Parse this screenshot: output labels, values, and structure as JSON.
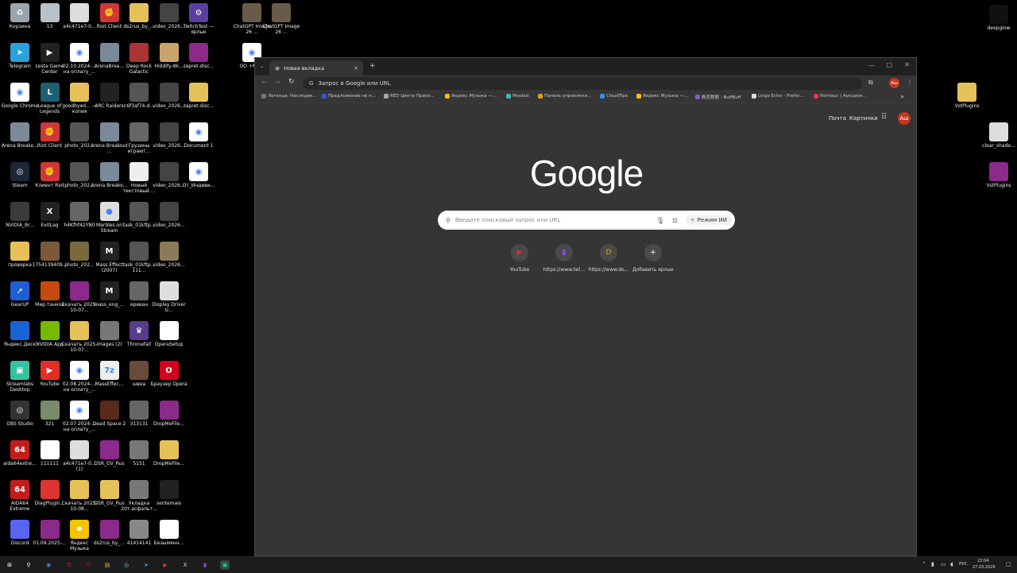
{
  "desktop_icons": [
    {
      "label": "Корзина",
      "icon": "recycle-bin-icon",
      "color": "#9aa4ad",
      "glyph": "♻"
    },
    {
      "label": "13",
      "icon": "file-icon",
      "color": "#b8c0c8",
      "glyph": ""
    },
    {
      "label": "a4c471e7-0...",
      "icon": "image-file-icon",
      "color": "#ddd",
      "glyph": ""
    },
    {
      "label": "Riot Client",
      "icon": "riot-client-icon",
      "color": "#d13639",
      "glyph": "✊"
    },
    {
      "label": "ds2rus_by_...",
      "icon": "folder-icon",
      "color": "#e6c15a",
      "glyph": ""
    },
    {
      "label": "video_2026...",
      "icon": "video-file-icon",
      "color": "#444",
      "glyph": ""
    },
    {
      "label": "TwitchTest — ярлык",
      "icon": "twitch-test-icon",
      "color": "#5b3fa0",
      "glyph": "⚙"
    },
    {
      "label": "Telegram",
      "icon": "telegram-icon",
      "color": "#2aa1da",
      "glyph": "➤"
    },
    {
      "label": "Lesta Game Center",
      "icon": "lesta-game-center-icon",
      "color": "#222",
      "glyph": "▶"
    },
    {
      "label": "02.10.2024-... на оплату_...",
      "icon": "chrome-doc-icon",
      "color": "#fff",
      "glyph": "◉"
    },
    {
      "label": "ArenaBrea...",
      "icon": "arena-breakout-icon",
      "color": "#7a8a99",
      "glyph": ""
    },
    {
      "label": "Deep Rock Galactic",
      "icon": "deep-rock-galactic-icon",
      "color": "#a33",
      "glyph": ""
    },
    {
      "label": "Hiddify-Wi...",
      "icon": "hiddify-icon",
      "color": "#c9a46a",
      "glyph": ""
    },
    {
      "label": "zapret-disc...",
      "icon": "winrar-icon",
      "color": "#8b2a8a",
      "glyph": ""
    },
    {
      "label": "Google Chrome",
      "icon": "chrome-icon",
      "color": "#fff",
      "glyph": "◉"
    },
    {
      "label": "League of Legends",
      "icon": "league-of-legends-icon",
      "color": "#1d5f73",
      "glyph": "L"
    },
    {
      "label": "goodbyed... — копия",
      "icon": "folder-icon",
      "color": "#e6c15a",
      "glyph": ""
    },
    {
      "label": "ARC Raiders",
      "icon": "arc-raiders-icon",
      "color": "#222",
      "glyph": ""
    },
    {
      "label": "c6f3af74-d...",
      "icon": "image-file-icon",
      "color": "#555",
      "glyph": ""
    },
    {
      "label": "video_2026...",
      "icon": "video-file-icon",
      "color": "#444",
      "glyph": ""
    },
    {
      "label": "zapret-disc...",
      "icon": "folder-icon",
      "color": "#e6c15a",
      "glyph": ""
    },
    {
      "label": "Arena Breako...",
      "icon": "arena-breakout-icon",
      "color": "#7a8a99",
      "glyph": ""
    },
    {
      "label": "Riot Client",
      "icon": "riot-client-icon",
      "color": "#d13639",
      "glyph": "✊"
    },
    {
      "label": "photo_202...",
      "icon": "photo-file-icon",
      "color": "#555",
      "glyph": ""
    },
    {
      "label": "Arena Breakout ...",
      "icon": "arena-breakout-icon",
      "color": "#7a8a99",
      "glyph": ""
    },
    {
      "label": "Грузины играют...",
      "icon": "video-file-icon",
      "color": "#666",
      "glyph": ""
    },
    {
      "label": "video_2026...",
      "icon": "video-file-icon",
      "color": "#444",
      "glyph": ""
    },
    {
      "label": "Document 1",
      "icon": "chrome-doc-icon",
      "color": "#fff",
      "glyph": "◉"
    },
    {
      "label": "Steam",
      "icon": "steam-icon",
      "color": "#1b2838",
      "glyph": "◎"
    },
    {
      "label": "Клиент Riot",
      "icon": "riot-client-icon",
      "color": "#d13639",
      "glyph": "✊"
    },
    {
      "label": "photo_202...",
      "icon": "photo-file-icon",
      "color": "#555",
      "glyph": ""
    },
    {
      "label": "Arena Breako...",
      "icon": "arena-breakout-icon",
      "color": "#7a8a99",
      "glyph": ""
    },
    {
      "label": "Новый текстовый ...",
      "icon": "text-file-icon",
      "color": "#eee",
      "glyph": ""
    },
    {
      "label": "video_2026...",
      "icon": "video-file-icon",
      "color": "#444",
      "glyph": ""
    },
    {
      "label": "От_Индиви...",
      "icon": "chrome-doc-icon",
      "color": "#fff",
      "glyph": "◉"
    },
    {
      "label": "NVIDIA_Br...",
      "icon": "nvidia-icon",
      "color": "#3b3b3b",
      "glyph": ""
    },
    {
      "label": "ExitLag",
      "icon": "exitlag-icon",
      "color": "#222",
      "glyph": "X"
    },
    {
      "label": "h4Kfhf42YN0",
      "icon": "photo-file-icon",
      "color": "#666",
      "glyph": ""
    },
    {
      "label": "Marbles on Stream",
      "icon": "marbles-icon",
      "color": "#ddd",
      "glyph": "●"
    },
    {
      "label": "task_01kftp...",
      "icon": "video-file-icon",
      "color": "#555",
      "glyph": ""
    },
    {
      "label": "video_2026...",
      "icon": "video-file-icon",
      "color": "#444",
      "glyph": ""
    },
    {
      "label": "",
      "icon": "",
      "color": "",
      "glyph": ""
    },
    {
      "label": "проверка",
      "icon": "folder-icon",
      "color": "#e6c15a",
      "glyph": ""
    },
    {
      "label": "1754139409...",
      "icon": "photo-file-icon",
      "color": "#7a5a3a",
      "glyph": ""
    },
    {
      "label": "photo_202...",
      "icon": "photo-file-icon",
      "color": "#7a6a3a",
      "glyph": ""
    },
    {
      "label": "Mass Effect (2007)",
      "icon": "mass-effect-icon",
      "color": "#222",
      "glyph": "M"
    },
    {
      "label": "task_01kftp... 111...",
      "icon": "video-file-icon",
      "color": "#555",
      "glyph": ""
    },
    {
      "label": "video_2026...",
      "icon": "video-file-icon",
      "color": "#8a7a5a",
      "glyph": ""
    },
    {
      "label": "",
      "icon": "",
      "color": "",
      "glyph": ""
    },
    {
      "label": "GearUP",
      "icon": "gearup-icon",
      "color": "#1f5fd1",
      "glyph": "➚"
    },
    {
      "label": "Мир танков",
      "icon": "world-of-tanks-icon",
      "color": "#c54a12",
      "glyph": ""
    },
    {
      "label": "Скачать 2025-10-07...",
      "icon": "winrar-icon",
      "color": "#8b2a8a",
      "glyph": ""
    },
    {
      "label": "mass_eng_...",
      "icon": "mass-effect-icon",
      "color": "#222",
      "glyph": "M"
    },
    {
      "label": "ереван",
      "icon": "photo-file-icon",
      "color": "#666",
      "glyph": ""
    },
    {
      "label": "Display Driver U...",
      "icon": "ddu-icon",
      "color": "#ddd",
      "glyph": ""
    },
    {
      "label": "",
      "icon": "",
      "color": "",
      "glyph": ""
    },
    {
      "label": "Яндекс.Диск",
      "icon": "yandex-disk-icon",
      "color": "#1a63d6",
      "glyph": ""
    },
    {
      "label": "NVIDIA App",
      "icon": "nvidia-app-icon",
      "color": "#76b900",
      "glyph": ""
    },
    {
      "label": "Скачать 2025-10-07...",
      "icon": "folder-icon",
      "color": "#e6c15a",
      "glyph": ""
    },
    {
      "label": "images (2)",
      "icon": "image-file-icon",
      "color": "#777",
      "glyph": ""
    },
    {
      "label": "Thronefall",
      "icon": "thronefall-icon",
      "color": "#5a3a8a",
      "glyph": "♛"
    },
    {
      "label": "OperaSetup",
      "icon": "opera-setup-icon",
      "color": "#fff",
      "glyph": ""
    },
    {
      "label": "",
      "icon": "",
      "color": "",
      "glyph": ""
    },
    {
      "label": "Streamlabs Desktop",
      "icon": "streamlabs-icon",
      "color": "#31c3a2",
      "glyph": "▣"
    },
    {
      "label": "YouTube",
      "icon": "youtube-icon",
      "color": "#e52d27",
      "glyph": "▶"
    },
    {
      "label": "02.08.2024-... на оплату_...",
      "icon": "chrome-doc-icon",
      "color": "#fff",
      "glyph": "◉"
    },
    {
      "label": "MassEffec...",
      "icon": "7zip-icon",
      "color": "#eee",
      "glyph": "7z"
    },
    {
      "label": "швеа",
      "icon": "photo-file-icon",
      "color": "#6a4a3a",
      "glyph": ""
    },
    {
      "label": "Браузер Opera",
      "icon": "opera-icon",
      "color": "#d5001c",
      "glyph": "O"
    },
    {
      "label": "",
      "icon": "",
      "color": "",
      "glyph": ""
    },
    {
      "label": "OBS Studio",
      "icon": "obs-icon",
      "color": "#333",
      "glyph": "◎"
    },
    {
      "label": "321",
      "icon": "image-file-icon",
      "color": "#7a8a6a",
      "glyph": ""
    },
    {
      "label": "02.07.2024-... на оплату_...",
      "icon": "chrome-doc-icon",
      "color": "#fff",
      "glyph": "◉"
    },
    {
      "label": "Dead Space 2",
      "icon": "dead-space-icon",
      "color": "#5a2a1a",
      "glyph": ""
    },
    {
      "label": "313131",
      "icon": "photo-file-icon",
      "color": "#666",
      "glyph": ""
    },
    {
      "label": "DropMeFile...",
      "icon": "winrar-icon",
      "color": "#8b2a8a",
      "glyph": ""
    },
    {
      "label": "",
      "icon": "",
      "color": "",
      "glyph": ""
    },
    {
      "label": "aida64extre...",
      "icon": "aida64-icon",
      "color": "#c41c1c",
      "glyph": "64"
    },
    {
      "label": "111111",
      "icon": "image-file-icon",
      "color": "#fff",
      "glyph": ""
    },
    {
      "label": "a4c471e7-0... (1)",
      "icon": "image-file-icon",
      "color": "#ddd",
      "glyph": ""
    },
    {
      "label": "DSR_GV_Rus",
      "icon": "winrar-icon",
      "color": "#8b2a8a",
      "glyph": ""
    },
    {
      "label": "5151",
      "icon": "photo-file-icon",
      "color": "#777",
      "glyph": ""
    },
    {
      "label": "DropMeFile...",
      "icon": "folder-icon",
      "color": "#e6c15a",
      "glyph": ""
    },
    {
      "label": "",
      "icon": "",
      "color": "",
      "glyph": ""
    },
    {
      "label": "AIDA64 Extreme",
      "icon": "aida64-icon",
      "color": "#c41c1c",
      "glyph": "64"
    },
    {
      "label": "DiagPlugin...",
      "icon": "diag-plugin-icon",
      "color": "#d33",
      "glyph": ""
    },
    {
      "label": "Скачать 2025-10-08...",
      "icon": "folder-icon",
      "color": "#e6c15a",
      "glyph": ""
    },
    {
      "label": "DSR_GV_Rus",
      "icon": "folder-icon",
      "color": "#e6c15a",
      "glyph": ""
    },
    {
      "label": "Укладка 20т.асфальт...",
      "icon": "photo-file-icon",
      "color": "#777",
      "glyph": ""
    },
    {
      "label": "sentemais",
      "icon": "image-file-icon",
      "color": "#222",
      "glyph": ""
    },
    {
      "label": "",
      "icon": "",
      "color": "",
      "glyph": ""
    },
    {
      "label": "Discord",
      "icon": "discord-icon",
      "color": "#5865f2",
      "glyph": ""
    },
    {
      "label": "01.09.2025-...",
      "icon": "winrar-icon",
      "color": "#8b2a8a",
      "glyph": ""
    },
    {
      "label": "Яндекс Музыка",
      "icon": "yandex-music-icon",
      "color": "#f5c400",
      "glyph": "✸"
    },
    {
      "label": "ds2rus_by_...",
      "icon": "winrar-icon",
      "color": "#8b2a8a",
      "glyph": ""
    },
    {
      "label": "41414141",
      "icon": "photo-file-icon",
      "color": "#888",
      "glyph": ""
    },
    {
      "label": "Безымянн...",
      "icon": "image-file-icon",
      "color": "#fff",
      "glyph": ""
    },
    {
      "label": "",
      "icon": "",
      "color": "",
      "glyph": ""
    }
  ],
  "top_files": [
    {
      "label": "ChatGPT Image 26 ...",
      "icon": "image-file-icon"
    },
    {
      "label": "ChatGPT Image 26 ...",
      "icon": "image-file-icon"
    },
    {
      "label": "OO +МАРІ",
      "icon": "chrome-doc-icon"
    }
  ],
  "right_icons": [
    {
      "label": "deepglow",
      "icon": "deepglow-icon",
      "color": "#111"
    },
    {
      "label": "VstPlugins",
      "icon": "folder-icon",
      "color": "#e6c15a"
    },
    {
      "label": "clear_shade...",
      "icon": "image-file-icon",
      "color": "#ddd"
    },
    {
      "label": "VstPlugins",
      "icon": "winrar-icon",
      "color": "#8b2a8a"
    }
  ],
  "chrome": {
    "tab_title": "Новая вкладка",
    "omnibox_placeholder": "Запрос в Google или URL",
    "profile_initials": "Аш",
    "header_links": {
      "mail": "Почта",
      "images": "Картинки"
    },
    "logo": "Google",
    "search_placeholder": "Введите поисковый запрос или URL",
    "ai_mode_label": "Режим ИИ",
    "bookmarks": [
      {
        "label": "Легенда: Наследие...",
        "color": "#777"
      },
      {
        "label": "Предложение не н...",
        "color": "#2b5bd7"
      },
      {
        "label": "RED Центр Прихо...",
        "color": "#aaa"
      },
      {
        "label": "Яндекс Музыка —...",
        "color": "#f5c400"
      },
      {
        "label": "Moobot",
        "color": "#3bb"
      },
      {
        "label": "Панель управлени...",
        "color": "#f39c12"
      },
      {
        "label": "CloudTips",
        "color": "#3a8ee6"
      },
      {
        "label": "Яндекс Музыка —...",
        "color": "#f5c400"
      },
      {
        "label": "概览数据 - BuffBuff",
        "color": "#8a5ad1"
      },
      {
        "label": "Lingo Echo – Prefer...",
        "color": "#ddd"
      },
      {
        "label": "Pointauc | Аукцион...",
        "color": "#e34"
      }
    ],
    "shortcuts": [
      {
        "label": "YouTube",
        "icon": "youtube-icon",
        "glyph": "▶",
        "color": "#e52d27"
      },
      {
        "label": "https://www.twi...",
        "icon": "twitch-icon",
        "glyph": "▮",
        "color": "#9147ff"
      },
      {
        "label": "https://www.do...",
        "icon": "donationalerts-icon",
        "glyph": "D",
        "color": "#f59c1a"
      },
      {
        "label": "Добавить ярлык",
        "icon": "plus-icon",
        "glyph": "+",
        "color": "#fff"
      }
    ]
  },
  "taskbar": {
    "language": "РУС",
    "time": "22:04",
    "date": "27.03.2026",
    "apps": [
      {
        "icon": "windows-start-icon",
        "glyph": "⊞",
        "color": "#fff"
      },
      {
        "icon": "search-icon",
        "glyph": "⚲",
        "color": "#fff"
      },
      {
        "icon": "chrome-icon",
        "glyph": "◉",
        "color": "#4285f4"
      },
      {
        "icon": "opera-gx-icon",
        "glyph": "O",
        "color": "#e0245e"
      },
      {
        "icon": "opera-icon",
        "glyph": "O",
        "color": "#d5001c"
      },
      {
        "icon": "file-explorer-icon",
        "glyph": "▤",
        "color": "#f5c400"
      },
      {
        "icon": "steam-icon",
        "glyph": "◎",
        "color": "#66c0f4"
      },
      {
        "icon": "telegram-icon",
        "glyph": "➤",
        "color": "#2aa1da"
      },
      {
        "icon": "youtube-icon",
        "glyph": "▶",
        "color": "#e52d27"
      },
      {
        "icon": "exitlag-icon",
        "glyph": "X",
        "color": "#ddd"
      },
      {
        "icon": "twitch-icon",
        "glyph": "▮",
        "color": "#9147ff"
      },
      {
        "icon": "streamlabs-icon",
        "glyph": "▣",
        "color": "#31c3a2"
      }
    ]
  }
}
